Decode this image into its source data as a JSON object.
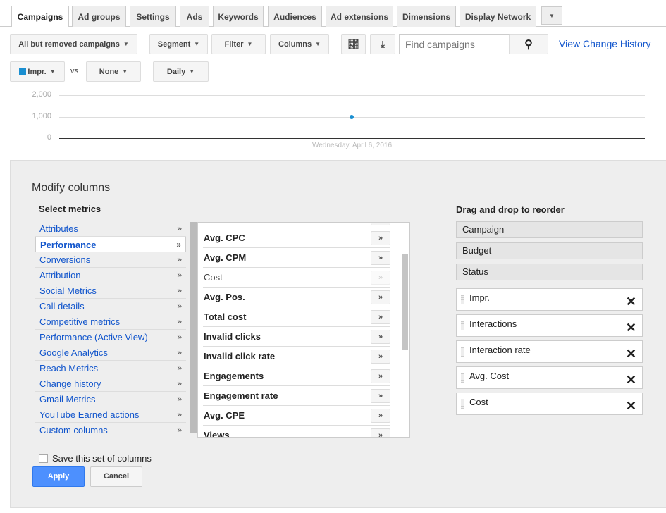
{
  "tabs": [
    "Campaigns",
    "Ad groups",
    "Settings",
    "Ads",
    "Keywords",
    "Audiences",
    "Ad extensions",
    "Dimensions",
    "Display Network"
  ],
  "toolbar": {
    "campaign_filter": "All but removed campaigns",
    "segment": "Segment",
    "filter": "Filter",
    "columns": "Columns",
    "search_placeholder": "Find campaigns",
    "change_history": "View Change History"
  },
  "chart_controls": {
    "metric1": "Impr.",
    "vs": "vs",
    "metric2": "None",
    "period": "Daily",
    "metric1_color": "#1a8fd1"
  },
  "chart_data": {
    "type": "line",
    "y_ticks": [
      "2,000",
      "1,000",
      "0"
    ],
    "ylim": [
      0,
      2000
    ],
    "x_label": "Wednesday, April 6, 2016",
    "points": [
      {
        "x": "Wednesday, April 6, 2016",
        "y": 1000
      }
    ]
  },
  "modify": {
    "title": "Modify columns",
    "select_metrics": "Select metrics",
    "reorder_title": "Drag and drop to reorder",
    "categories": [
      "Attributes",
      "Performance",
      "Conversions",
      "Attribution",
      "Social Metrics",
      "Call details",
      "Competitive metrics",
      "Performance (Active View)",
      "Google Analytics",
      "Reach Metrics",
      "Change history",
      "Gmail Metrics",
      "YouTube Earned actions",
      "Custom columns"
    ],
    "selected_category": "Performance",
    "metrics": [
      {
        "label": "Avg. CPC",
        "enabled": true
      },
      {
        "label": "Avg. CPM",
        "enabled": true
      },
      {
        "label": "Cost",
        "enabled": false
      },
      {
        "label": "Avg. Pos.",
        "enabled": true
      },
      {
        "label": "Total cost",
        "enabled": true
      },
      {
        "label": "Invalid clicks",
        "enabled": true
      },
      {
        "label": "Invalid click rate",
        "enabled": true
      },
      {
        "label": "Engagements",
        "enabled": true
      },
      {
        "label": "Engagement rate",
        "enabled": true
      },
      {
        "label": "Avg. CPE",
        "enabled": true
      },
      {
        "label": "Views",
        "enabled": true
      }
    ],
    "add_symbol": "»",
    "fixed_columns": [
      "Campaign",
      "Budget",
      "Status"
    ],
    "selected_columns": [
      "Impr.",
      "Interactions",
      "Interaction rate",
      "Avg. Cost",
      "Cost"
    ],
    "save_label": "Save this set of columns",
    "apply": "Apply",
    "cancel": "Cancel"
  }
}
